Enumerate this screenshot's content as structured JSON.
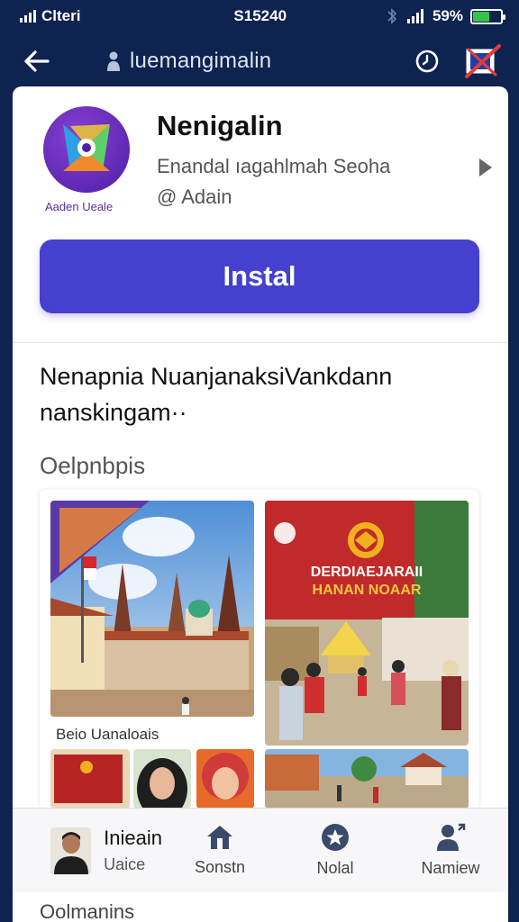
{
  "status_bar": {
    "carrier": "Clteri",
    "time": "S15240",
    "battery_percent": "59%",
    "battery_level": 0.59
  },
  "top_bar": {
    "search_text": "luemangimalin"
  },
  "app": {
    "title": "Nenigalin",
    "subtitle": "Enandal ıagahlmah Seoha",
    "developer": "@ Adain",
    "logo_caption": "Aaden Ueale",
    "install_label": "Instal"
  },
  "description": {
    "line1": "Nenapnia NuanjanaksiVankdann",
    "line2": "nanskingam··"
  },
  "screenshots": {
    "label": "Oelpnbpis",
    "caption": "Beio Uanaloais",
    "banner2_line1": "DERDIAEJARAII",
    "banner2_line2": "HANAN NOAAR"
  },
  "bottom_nav": {
    "profile_name": "Inieain",
    "profile_sub": "Uaice",
    "items": [
      {
        "label": "Sonstn",
        "icon": "home-icon"
      },
      {
        "label": "Nolal",
        "icon": "star-icon"
      },
      {
        "label": "Namiew",
        "icon": "person-icon"
      }
    ]
  },
  "footer": {
    "peek_text": "Oolmanins"
  },
  "colors": {
    "header_bg": "#0f2350",
    "accent": "#4640cf",
    "battery_green": "#39c24a"
  }
}
